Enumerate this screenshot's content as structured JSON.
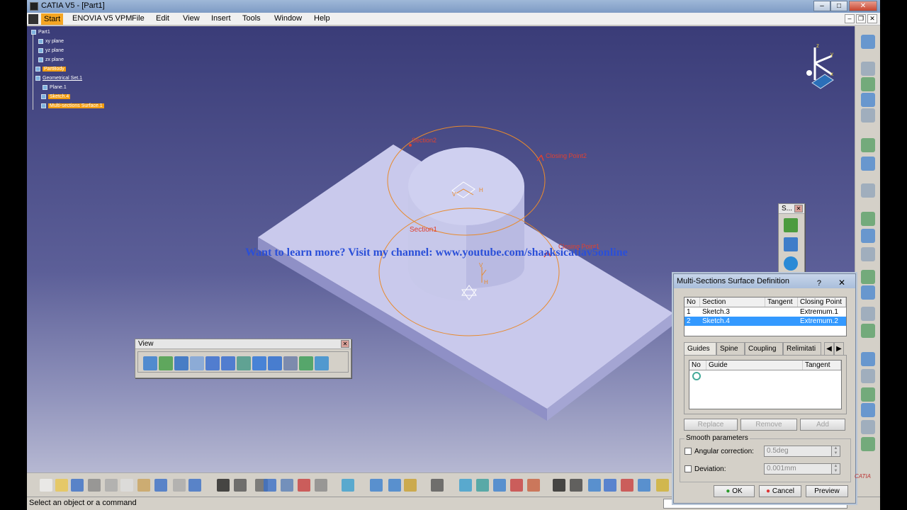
{
  "window": {
    "title": "CATIA V5 - [Part1]"
  },
  "menu": [
    {
      "label": "Start",
      "active": true
    },
    {
      "label": "ENOVIA V5 VPM"
    },
    {
      "label": "File"
    },
    {
      "label": "Edit"
    },
    {
      "label": "View"
    },
    {
      "label": "Insert"
    },
    {
      "label": "Tools"
    },
    {
      "label": "Window"
    },
    {
      "label": "Help"
    }
  ],
  "tree": {
    "root": "Part1",
    "planes": [
      "xy plane",
      "yz plane",
      "zx plane"
    ],
    "part_body": "PartBody",
    "geo_set": "Geometrical Set.1",
    "plane1": "Plane.1",
    "sketch4": "Sketch.4",
    "surface": "Multi-sections Surface.1"
  },
  "labels": {
    "section_top": "Section2",
    "closing_top": "Closing Point2",
    "section_bottom": "Section1",
    "closing_bottom": "Closing Point1",
    "axis_v": "V",
    "axis_h": "H"
  },
  "watermark": "Want to learn more? Visit my channel: www.youtube.com/shaaksicatiav5online",
  "compass": {
    "x": "x",
    "y": "y",
    "z": "z"
  },
  "view_toolbar": {
    "title": "View",
    "icons": [
      "fly-mode-icon",
      "fit-all-in-icon",
      "pan-icon",
      "rotate-icon",
      "zoom-in-icon",
      "zoom-out-icon",
      "normal-view-icon",
      "multi-view-icon",
      "iso-view-icon",
      "shading-icon",
      "hide-show-icon",
      "swap-space-icon"
    ]
  },
  "small_toolbar": {
    "title": "S..."
  },
  "dialog": {
    "title": "Multi-Sections Surface Definition",
    "sections_header": [
      "No",
      "Section",
      "Tangent",
      "Closing Point"
    ],
    "sections": [
      [
        "1",
        "Sketch.3",
        "",
        "Extremum.1"
      ],
      [
        "2",
        "Sketch.4",
        "",
        "Extremum.2"
      ]
    ],
    "tabs": [
      "Guides",
      "Spine",
      "Coupling",
      "Relimitati"
    ],
    "guides_header": [
      "No",
      "Guide",
      "Tangent"
    ],
    "buttons": {
      "replace": "Replace",
      "remove": "Remove",
      "add": "Add"
    },
    "smooth_group": "Smooth parameters",
    "angular_label": "Angular correction:",
    "angular_value": "0.5deg",
    "deviation_label": "Deviation:",
    "deviation_value": "0.001mm",
    "ok": "OK",
    "cancel": "Cancel",
    "preview": "Preview"
  },
  "status": {
    "text": "Select an object or a command"
  },
  "brand": "CATIA"
}
